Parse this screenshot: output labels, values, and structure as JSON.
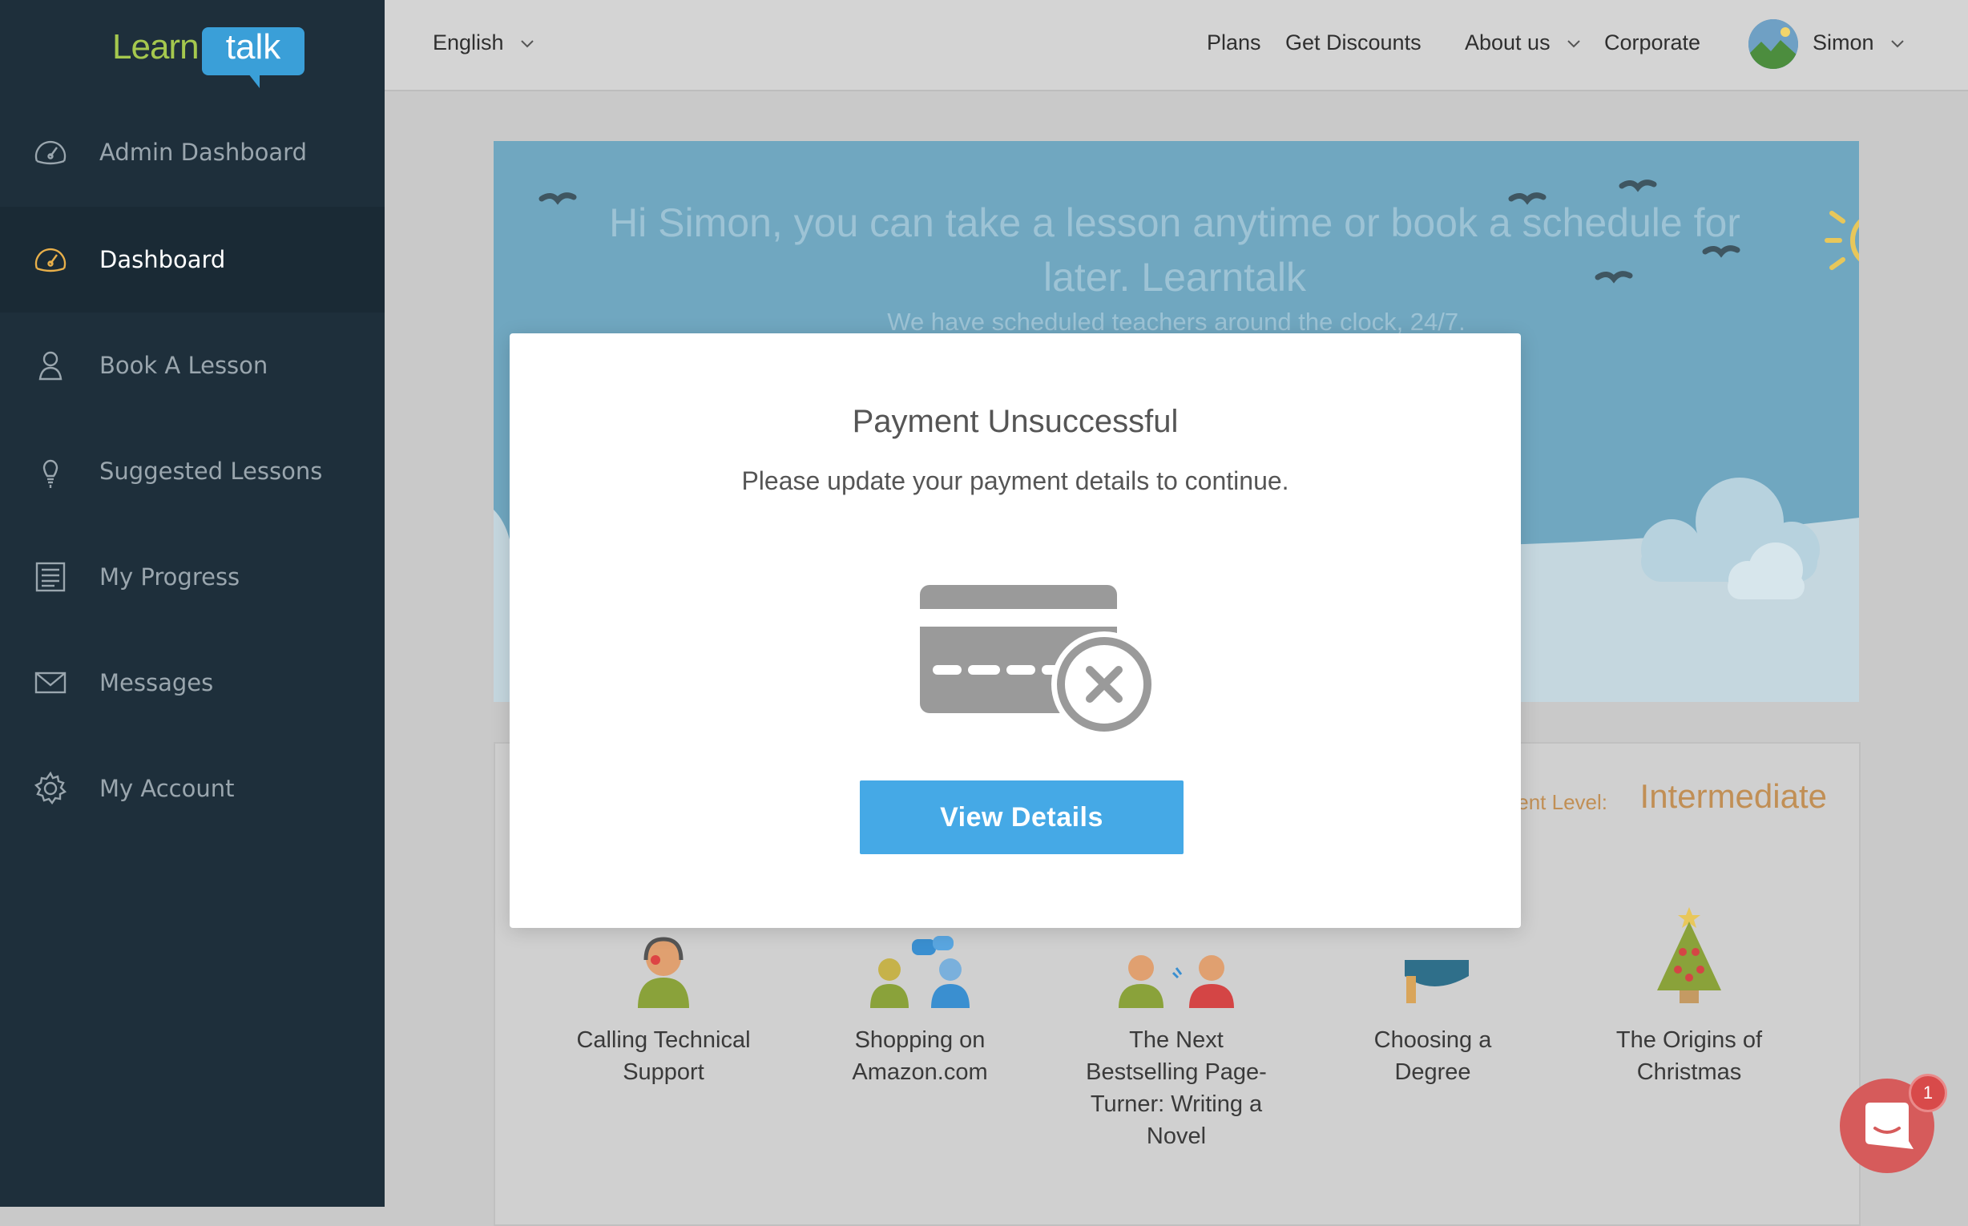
{
  "brand": {
    "learn": "Learn",
    "talk": "talk"
  },
  "sidebar": {
    "items": [
      {
        "label": "Admin Dashboard",
        "icon": "gauge-icon"
      },
      {
        "label": "Dashboard",
        "icon": "gauge-icon",
        "active": true
      },
      {
        "label": "Book A Lesson",
        "icon": "person-icon"
      },
      {
        "label": "Suggested Lessons",
        "icon": "lightbulb-icon"
      },
      {
        "label": "My Progress",
        "icon": "document-icon"
      },
      {
        "label": "Messages",
        "icon": "envelope-icon"
      },
      {
        "label": "My Account",
        "icon": "gear-icon"
      }
    ]
  },
  "header": {
    "language": "English",
    "links": {
      "plans": "Plans",
      "discounts": "Get Discounts",
      "about": "About us",
      "corporate": "Corporate"
    },
    "user": "Simon"
  },
  "banner": {
    "title": "Hi Simon, you can take a lesson anytime or book a schedule for later. Learntalk",
    "subtitle": "We have scheduled teachers around the clock, 24/7."
  },
  "lessons": {
    "level_label": "ent Level:",
    "level_value": "Intermediate",
    "items": [
      {
        "title": "Calling Technical Support"
      },
      {
        "title": "Shopping on Amazon.com"
      },
      {
        "title": "The Next Bestselling Page-Turner: Writing a Novel"
      },
      {
        "title": "Choosing a Degree"
      },
      {
        "title": "The Origins of Christmas"
      }
    ]
  },
  "modal": {
    "title": "Payment Unsuccessful",
    "message": "Please update your payment details to continue.",
    "button": "View Details"
  },
  "chat": {
    "badge": "1"
  },
  "colors": {
    "sidebar": "#1e2f3b",
    "accent": "#45a9e6",
    "level": "#c18f55",
    "chat": "#d65b5b"
  }
}
